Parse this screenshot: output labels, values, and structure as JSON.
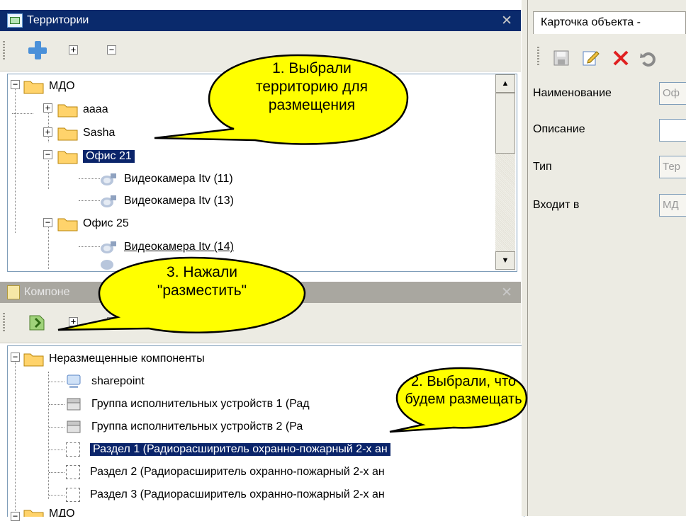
{
  "territories_panel": {
    "title": "Территории",
    "tree": {
      "root": "МДО",
      "items": [
        "aaaa",
        "Sasha",
        "Офис 21",
        "Видеокамера Itv (11)",
        "Видеокамера Itv (13)",
        "Офис 25",
        "Видеокамера Itv (14)"
      ]
    }
  },
  "components_panel": {
    "title": "Компоне",
    "tree": {
      "root": "Неразмещенные компоненты",
      "items": [
        "sharepoint",
        "Группа исполнительных устройств 1 (Рад",
        "Группа исполнительных устройств 2 (Ра",
        "Раздел 1 (Радиорасширитель охранно-пожарный 2-х ан",
        "Раздел 2 (Радиорасширитель охранно-пожарный 2-х ан",
        "Раздел 3 (Радиорасширитель охранно-пожарный 2-х ан"
      ],
      "bottom_root": "МДО"
    }
  },
  "object_card": {
    "tab_title": "Карточка объекта - ",
    "fields": [
      {
        "label": "Наименование",
        "value": "Оф"
      },
      {
        "label": "Описание",
        "value": ""
      },
      {
        "label": "Тип",
        "value": "Тер"
      },
      {
        "label": "Входит в",
        "value": "МД"
      }
    ]
  },
  "callouts": {
    "c1": [
      "1. Выбрали",
      "территорию для",
      "размещения"
    ],
    "c2": [
      "2. Выбрали, что",
      "будем размещать"
    ],
    "c3": [
      "3. Нажали",
      "\"разместить\""
    ]
  },
  "colors": {
    "title_active": "#0a2a6c",
    "selection": "#0a246a",
    "callout_fill": "#ffff00"
  }
}
